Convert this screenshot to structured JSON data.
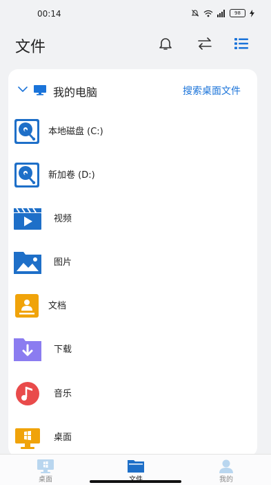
{
  "status": {
    "time": "00:14",
    "battery": "98"
  },
  "header": {
    "title": "文件"
  },
  "section": {
    "title": "我的电脑",
    "link": "搜索桌面文件"
  },
  "items": [
    {
      "label": "本地磁盘 (C:)",
      "icon": "drive-icon"
    },
    {
      "label": "新加卷 (D:)",
      "icon": "drive-icon"
    },
    {
      "label": "视频",
      "icon": "video-icon"
    },
    {
      "label": "图片",
      "icon": "image-icon"
    },
    {
      "label": "文档",
      "icon": "document-icon"
    },
    {
      "label": "下载",
      "icon": "download-folder-icon"
    },
    {
      "label": "音乐",
      "icon": "music-icon"
    },
    {
      "label": "桌面",
      "icon": "desktop-icon"
    }
  ],
  "nav": [
    {
      "label": "桌面",
      "icon": "desktop-icon",
      "active": false
    },
    {
      "label": "文件",
      "icon": "folder-icon",
      "active": true
    },
    {
      "label": "我的",
      "icon": "user-icon",
      "active": false
    }
  ],
  "colors": {
    "accent": "#1a73d9",
    "drive": "#1e6fc8",
    "document": "#f0a30a",
    "download": "#8b7cf0",
    "music": "#e94b4b"
  }
}
